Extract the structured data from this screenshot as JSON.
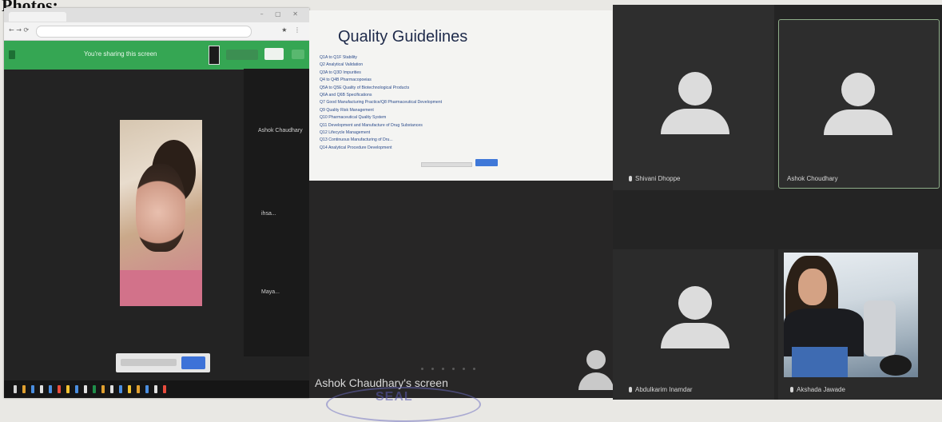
{
  "heading": "Photos:",
  "browser": {
    "sharing_banner": "You're sharing this screen",
    "participants": [
      "Ashok Chaudhary",
      "ihsa...",
      "Maya..."
    ]
  },
  "slide": {
    "title": "Quality Guidelines",
    "items": [
      "Q1A to Q1F Stability",
      "Q2 Analytical Validation",
      "Q3A to Q3D Impurities",
      "Q4 to Q4B Pharmacopoeias",
      "Q5A to Q5E Quality of Biotechnological Products",
      "Q6A and Q6B Specifications",
      "Q7 Good Manufacturing Practice/Q8 Pharmaceutical Development",
      "Q9 Quality Risk Management",
      "Q10 Pharmaceutical Quality System",
      "Q11 Development and Manufacture of Drug Substances",
      "Q12 Lifecycle Management",
      "Q13 Continuous Manufacturing of Dru...",
      "Q14 Analytical Procedure Development"
    ]
  },
  "share": {
    "label": "Ashok Chaudhary's screen"
  },
  "participants": [
    {
      "name": "Shivani Dhoppe",
      "active": false
    },
    {
      "name": "Ashok Choudhary",
      "active": true
    },
    {
      "name": "Abdulkarim Inamdar",
      "active": false
    },
    {
      "name": "Akshada Jawade",
      "active": false
    }
  ],
  "colors": {
    "meet_green": "#35a653",
    "tile_bg": "#2b2b2b",
    "active_border": "#8fae8a",
    "link_blue": "#2c4c8c"
  },
  "icons": {
    "avatar": "person-avatar-icon",
    "mic": "mic-icon"
  }
}
